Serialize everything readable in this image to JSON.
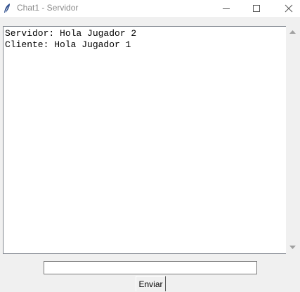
{
  "window": {
    "title": "Chat1 - Servidor",
    "icon": "feather-icon",
    "controls": [
      "minimize-icon",
      "maximize-icon",
      "close-icon"
    ]
  },
  "chat": {
    "lines": [
      "Servidor: Hola Jugador 2",
      "Cliente: Hola Jugador 1"
    ]
  },
  "input": {
    "value": "",
    "placeholder": ""
  },
  "send_button": {
    "label": "Enviar"
  }
}
